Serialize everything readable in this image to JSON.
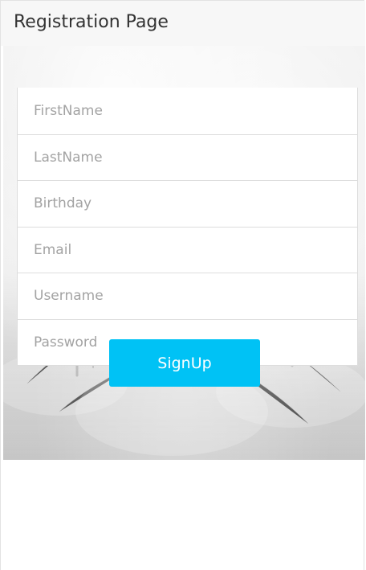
{
  "header": {
    "title": "Registration Page"
  },
  "form": {
    "fields": [
      {
        "name": "firstname",
        "placeholder": "FirstName",
        "value": ""
      },
      {
        "name": "lastname",
        "placeholder": "LastName",
        "value": ""
      },
      {
        "name": "birthday",
        "placeholder": "Birthday",
        "value": ""
      },
      {
        "name": "email",
        "placeholder": "Email",
        "value": ""
      },
      {
        "name": "username",
        "placeholder": "Username",
        "value": ""
      },
      {
        "name": "password",
        "placeholder": "Password",
        "value": ""
      }
    ],
    "signup_label": "SignUp"
  },
  "colors": {
    "header_bg": "#f7f7f7",
    "accent_button": "#00c2f5",
    "placeholder_text": "#a3a3a3",
    "border": "#dddddd"
  }
}
